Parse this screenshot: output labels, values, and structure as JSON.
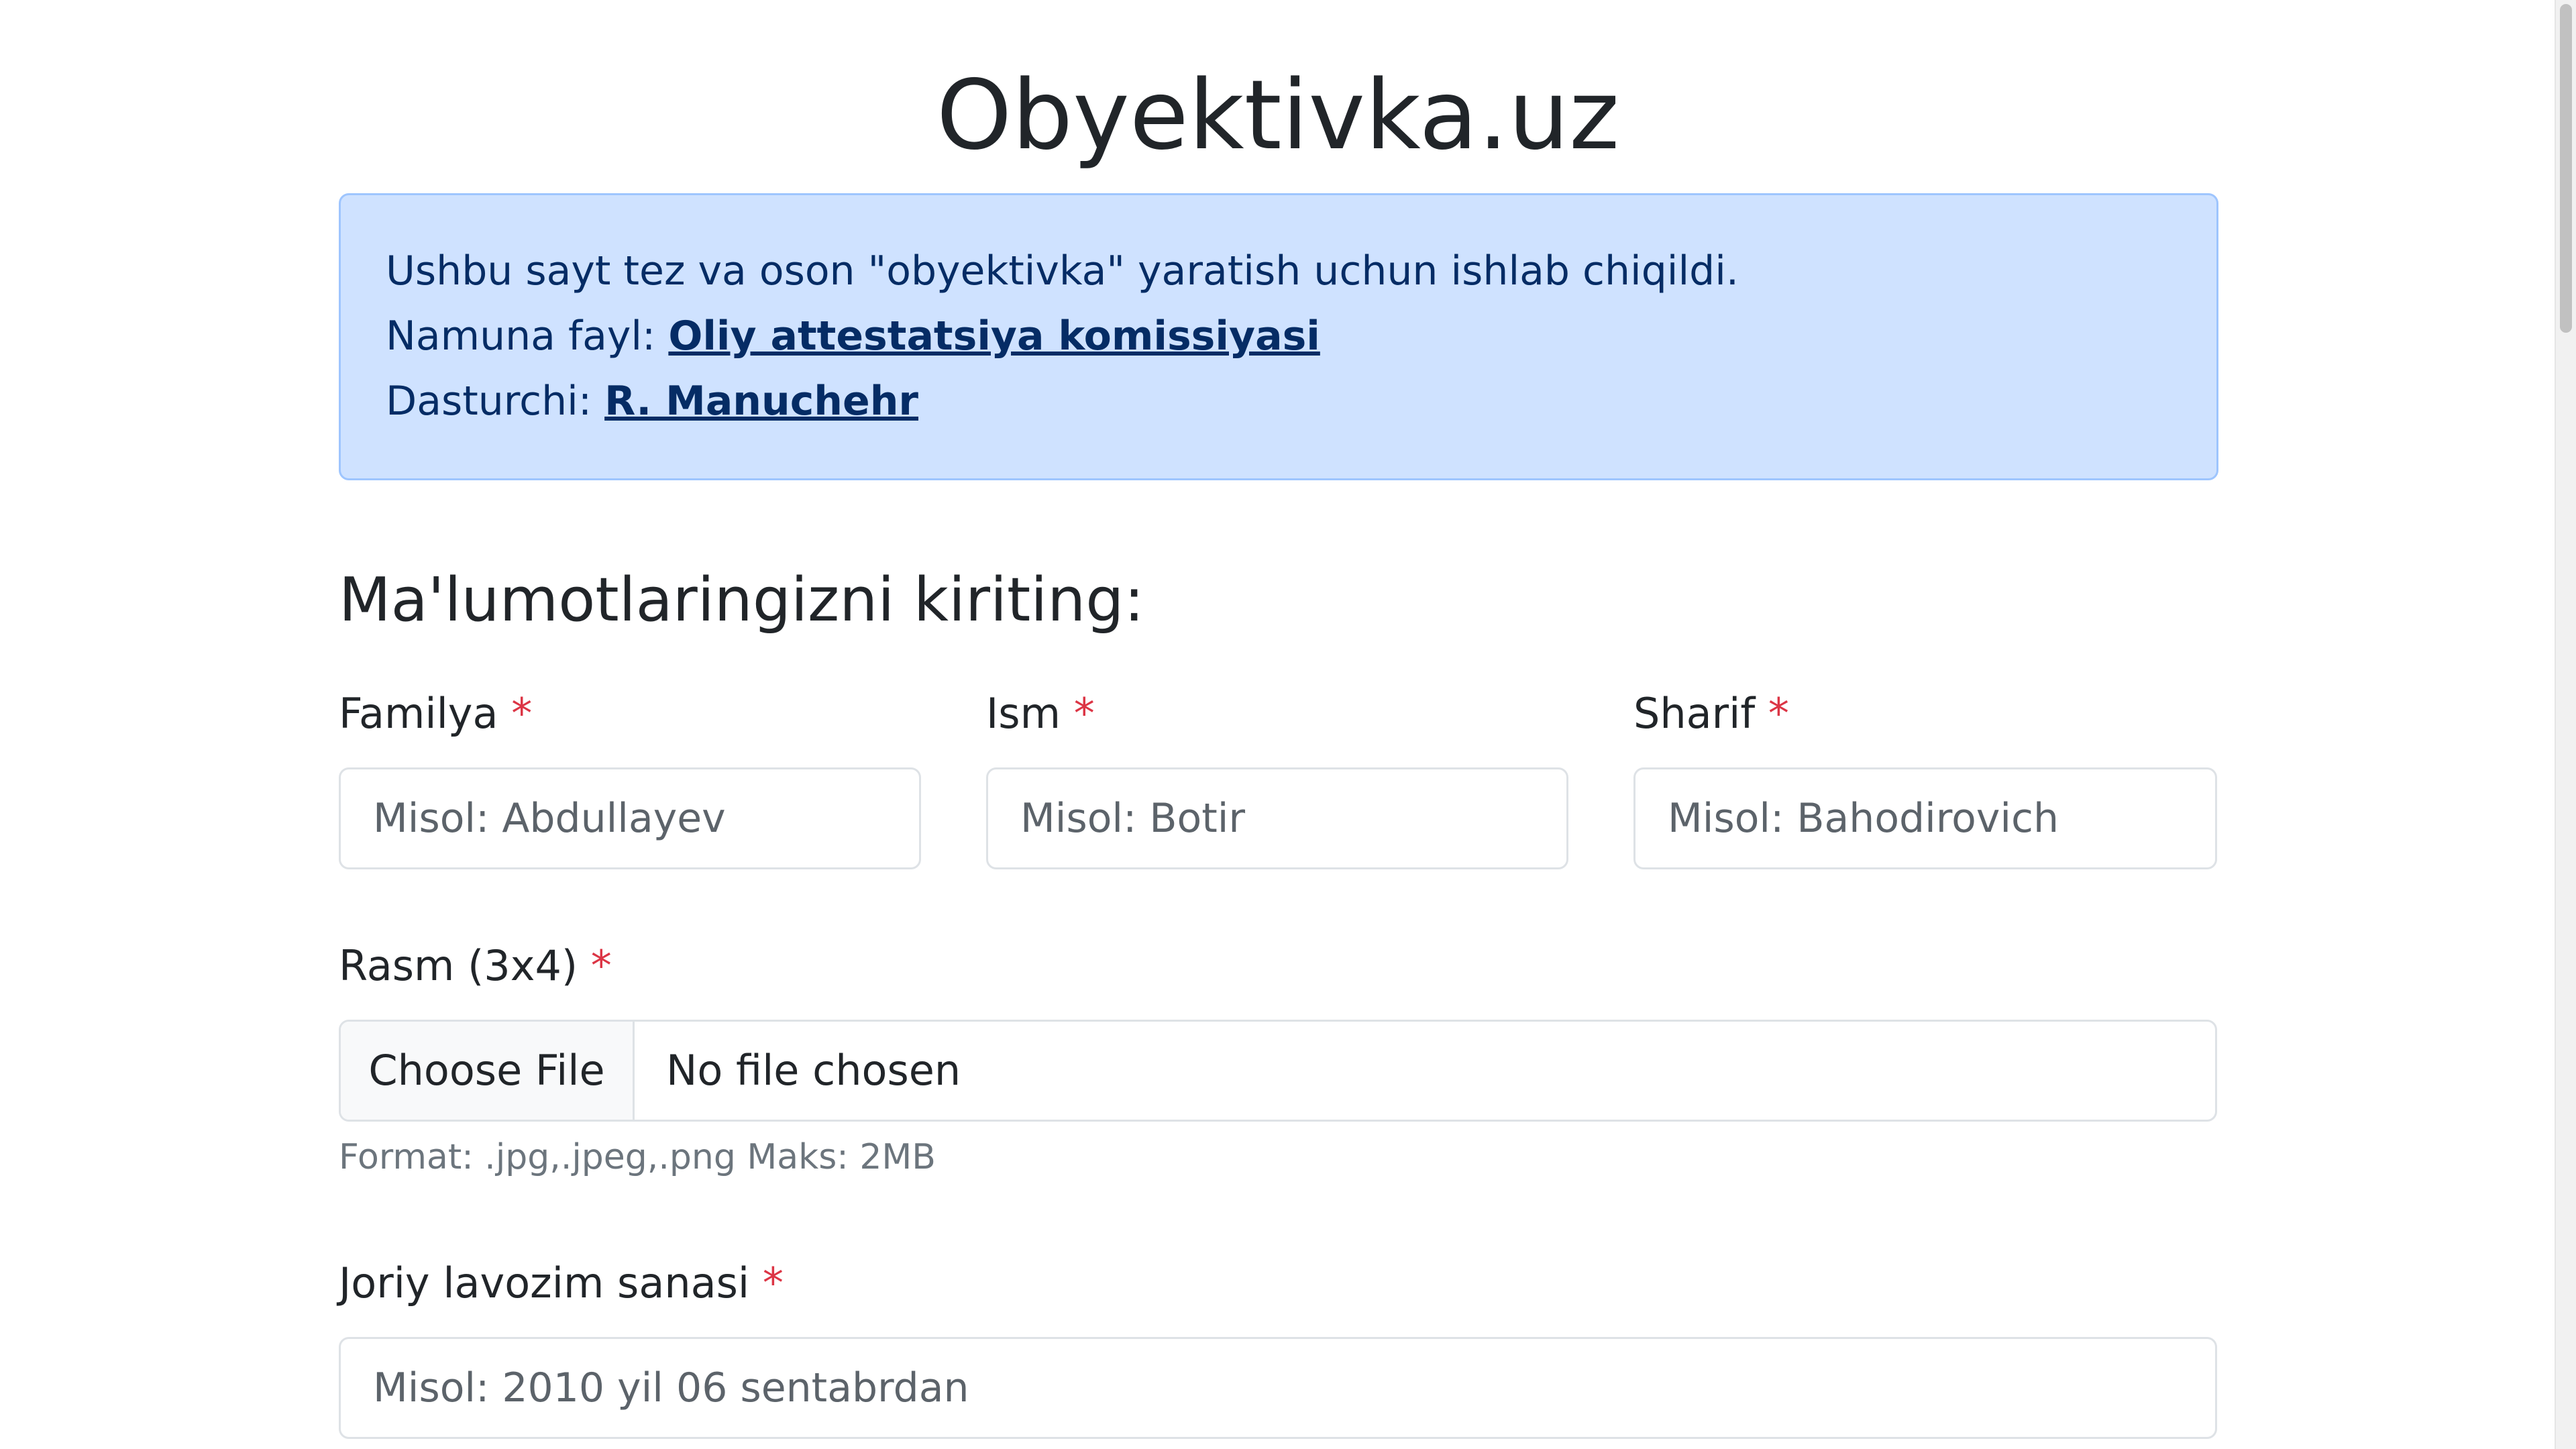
{
  "site": {
    "title": "Obyektivka.uz"
  },
  "info": {
    "line1": "Ushbu sayt tez va oson \"obyektivka\" yaratish uchun ishlab chiqildi.",
    "sample_label": "Namuna fayl: ",
    "sample_link": "Oliy attestatsiya komissiyasi",
    "developer_label": "Dasturchi: ",
    "developer_link": "R. Manuchehr"
  },
  "form": {
    "heading": "Ma'lumotlaringizni kiriting:",
    "required_mark": "*",
    "familiya": {
      "label": "Familya",
      "placeholder": "Misol: Abdullayev"
    },
    "ism": {
      "label": "Ism",
      "placeholder": "Misol: Botir"
    },
    "sharif": {
      "label": "Sharif",
      "placeholder": "Misol: Bahodirovich"
    },
    "rasm": {
      "label": "Rasm (3x4)",
      "button": "Choose File",
      "status": "No file chosen",
      "help": "Format: .jpg,.jpeg,.png Maks: 2MB"
    },
    "lavozim_sanasi": {
      "label": "Joriy lavozim sanasi",
      "placeholder": "Misol: 2010 yil 06 sentabrdan"
    }
  },
  "colors": {
    "info_bg": "#cfe2ff",
    "info_border": "#9ec5fe",
    "info_text": "#052c65",
    "required": "#dc3545",
    "muted": "#6c757d"
  }
}
